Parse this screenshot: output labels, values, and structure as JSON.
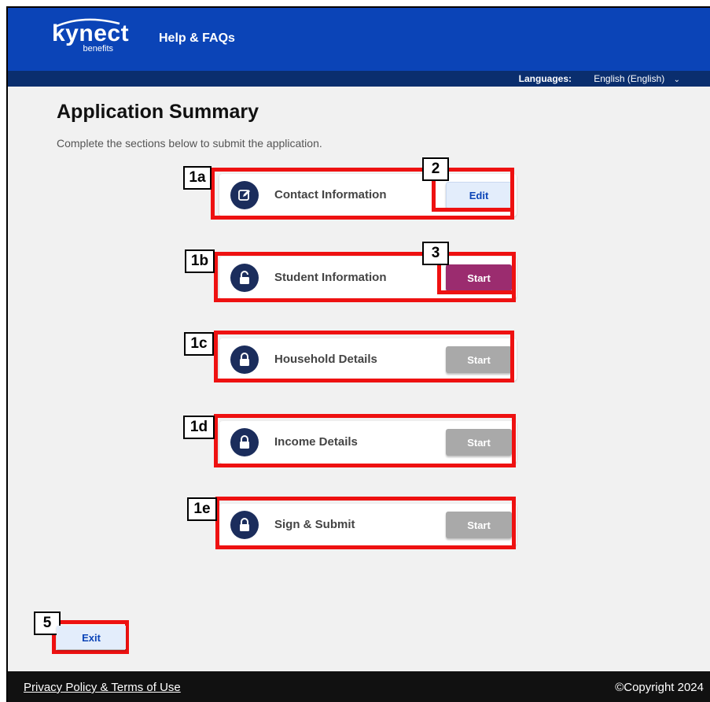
{
  "header": {
    "logo_main": "kynect",
    "logo_sub": "benefits",
    "help_link": "Help & FAQs",
    "languages_label": "Languages:",
    "language_selected": "English (English)"
  },
  "page": {
    "title": "Application Summary",
    "subtitle": "Complete the sections below to submit the application."
  },
  "sections": [
    {
      "label": "Contact Information",
      "button": "Edit",
      "icon": "edit-icon",
      "state": "complete"
    },
    {
      "label": "Student Information",
      "button": "Start",
      "icon": "unlock-icon",
      "state": "active"
    },
    {
      "label": "Household Details",
      "button": "Start",
      "icon": "lock-icon",
      "state": "locked"
    },
    {
      "label": "Income Details",
      "button": "Start",
      "icon": "lock-icon",
      "state": "locked"
    },
    {
      "label": "Sign & Submit",
      "button": "Start",
      "icon": "lock-icon",
      "state": "locked"
    }
  ],
  "callouts": {
    "c1a": "1a",
    "c1b": "1b",
    "c1c": "1c",
    "c1d": "1d",
    "c1e": "1e",
    "c2": "2",
    "c3": "3",
    "c5": "5"
  },
  "exit_label": "Exit",
  "footer": {
    "privacy": "Privacy Policy & Terms of Use",
    "copyright": "©Copyright 2024"
  },
  "colors": {
    "brand_blue": "#0b44b7",
    "navy": "#0a2e6e",
    "start_active": "#9b2c6f",
    "start_disabled": "#a9a9a9",
    "annotation_red": "#ee1111"
  }
}
